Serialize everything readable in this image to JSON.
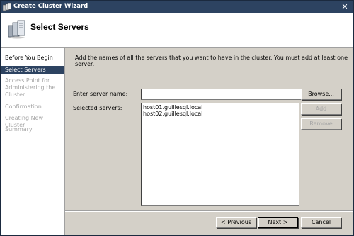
{
  "window": {
    "title": "Create Cluster Wizard",
    "close_glyph": "✕"
  },
  "header": {
    "title": "Select Servers"
  },
  "nav": {
    "items": [
      {
        "label": "Before You Begin",
        "state": "normal"
      },
      {
        "label": "Select Servers",
        "state": "active"
      },
      {
        "label": "Access Point for Administering the Cluster",
        "state": "disabled"
      },
      {
        "label": "Confirmation",
        "state": "disabled"
      },
      {
        "label": "Creating New Cluster",
        "state": "disabled"
      },
      {
        "label": "Summary",
        "state": "disabled"
      }
    ]
  },
  "main": {
    "instruction": "Add the names of all the servers that you want to have in the cluster. You must add at least one server.",
    "server_name_label": "Enter server name:",
    "server_name_value": "",
    "selected_label": "Selected servers:",
    "selected_servers": [
      "host01.guillesql.local",
      "host02.guillesql.local"
    ],
    "browse_label": "Browse...",
    "add_label": "Add",
    "remove_label": "Remove"
  },
  "footer": {
    "previous_label": "< Previous",
    "next_label": "Next >",
    "cancel_label": "Cancel"
  },
  "colors": {
    "titlebar": "#2d4361",
    "selection": "#2d4361",
    "dialog": "#d4d0c8",
    "disabled_text": "#a5a5a5"
  }
}
